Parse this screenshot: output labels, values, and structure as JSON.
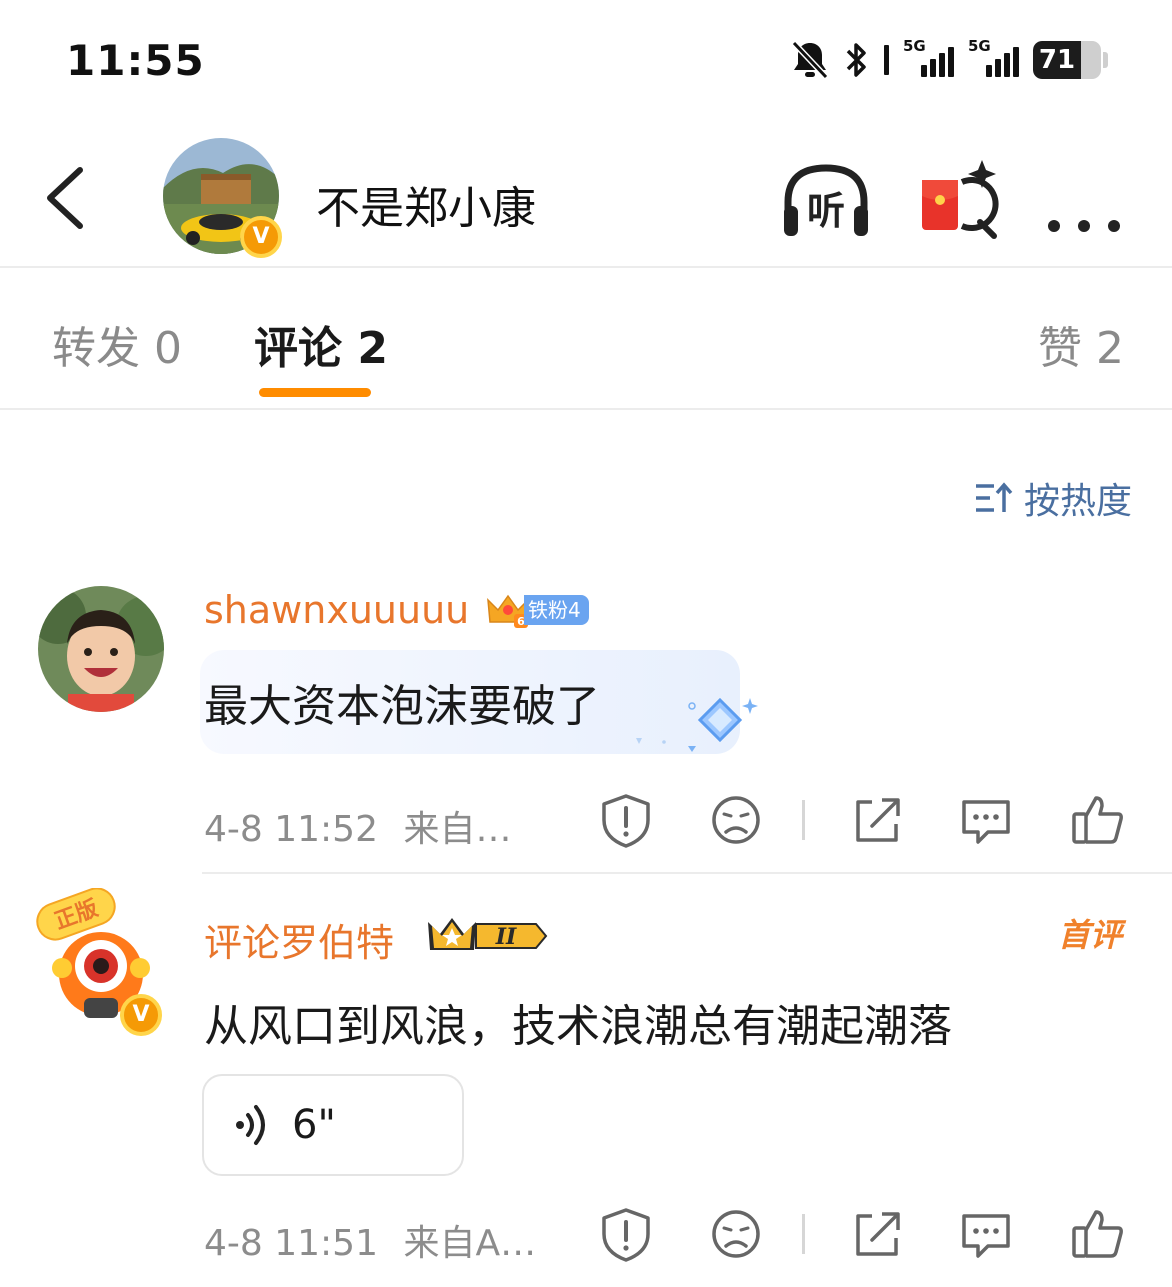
{
  "status": {
    "time": "11:55",
    "battery": 71,
    "network_1": "5G",
    "network_2": "5G"
  },
  "header": {
    "user_name": "不是郑小康",
    "verified_mark": "V",
    "listen_label": "听",
    "icons": [
      "back-icon",
      "listen-icon",
      "red-packet-search-icon",
      "more-icon"
    ]
  },
  "tabs": {
    "repost": "转发 0",
    "comment": "评论 2",
    "like": "赞 2",
    "active": "comment",
    "accent_color": "#ff8c00"
  },
  "sort": {
    "label": "按热度"
  },
  "comments": [
    {
      "user": "shawnxuuuuu",
      "fan_level_mark": "6",
      "fan_badge": "铁粉4",
      "text": "最大资本泡沫要破了",
      "time": "4-8 11:52",
      "source": "来自…",
      "name_color": "#e8762c"
    },
    {
      "user": "评论罗伯特",
      "member_badge": "II",
      "avatar_tag": "正版",
      "verified_mark": "V",
      "first_label": "首评",
      "text": "从风口到风浪，技术浪潮总有潮起潮落",
      "voice_duration": "6\"",
      "time": "4-8 11:51",
      "source": "来自A…",
      "name_color": "#e8762c"
    }
  ]
}
